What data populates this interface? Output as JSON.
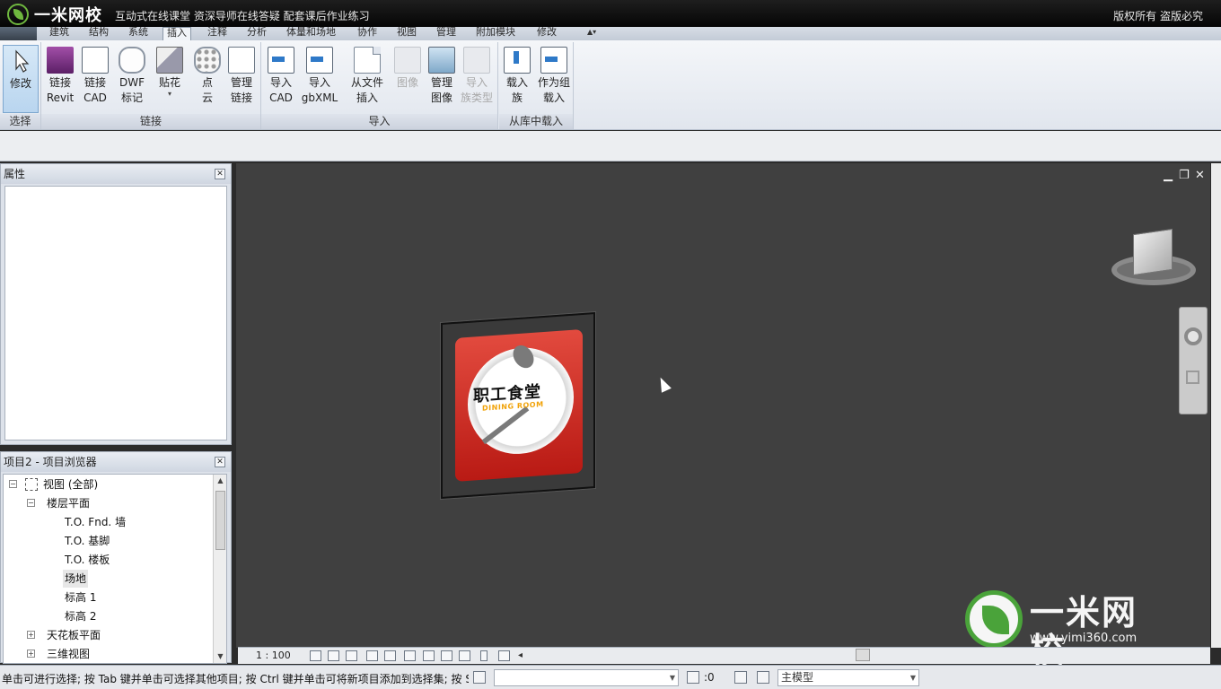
{
  "banner": {
    "logo_text": "一米网校",
    "slogan": "互动式在线课堂  资深导师在线答疑  配套课后作业练习",
    "copyright": "版权所有  盗版必究"
  },
  "tabs": [
    "建筑",
    "结构",
    "系统",
    "插入",
    "注释",
    "分析",
    "体量和场地",
    "协作",
    "视图",
    "管理",
    "附加模块",
    "修改"
  ],
  "active_tab": "插入",
  "ribbon": {
    "select_panel": {
      "title": "选择",
      "modify": "修改"
    },
    "link_panel": {
      "title": "链接",
      "link_revit_1": "链接",
      "link_revit_2": "Revit",
      "link_cad_1": "链接",
      "link_cad_2": "CAD",
      "dwf_1": "DWF",
      "dwf_2": "标记",
      "decal_1": "贴花",
      "pointcloud_1": "点",
      "pointcloud_2": "云",
      "manage_links_1": "管理",
      "manage_links_2": "链接"
    },
    "import_panel": {
      "title": "导入",
      "import_cad_1": "导入",
      "import_cad_2": "CAD",
      "import_gbxml_1": "导入",
      "import_gbxml_2": "gbXML",
      "insert_file_1": "从文件",
      "insert_file_2": "插入",
      "image_1": "图像",
      "manage_images_1": "管理",
      "manage_images_2": "图像",
      "import_family_types_1": "导入",
      "import_family_types_2": "族类型"
    },
    "library_panel": {
      "title": "从库中载入",
      "load_family_1": "载入",
      "load_family_2": "族",
      "load_group_1": "作为组",
      "load_group_2": "载入"
    }
  },
  "properties": {
    "title": "属性"
  },
  "project_browser": {
    "title": "项目2 - 项目浏览器",
    "root": "视图 (全部)",
    "floor_plans": "楼层平面",
    "items": [
      "T.O. Fnd. 墙",
      "T.O. 基脚",
      "T.O. 楼板",
      "场地",
      "标高 1",
      "标高 2"
    ],
    "selected_item": "场地",
    "ceiling_plans": "天花板平面",
    "views_3d": "三维视图"
  },
  "viewport": {
    "sign_title": "职工食堂",
    "sign_subtitle": "DINING ROOM",
    "watermark_text": "一米网校",
    "watermark_url": "www.yimi360.com"
  },
  "view_control": {
    "scale": "1 : 100"
  },
  "status_bar": {
    "message": "单击可进行选择; 按 Tab 键并单击可选择其他项目; 按 Ctrl 键并单击可将新项目添加到选择集; 按 Shift 键并单击可取消选择。",
    "workset_value": "",
    "selection_count": ":0",
    "model": "主模型"
  },
  "colors": {
    "brand_green": "#4aa33a",
    "view_background": "#404040",
    "ribbon_background": "#e1e6ee"
  }
}
